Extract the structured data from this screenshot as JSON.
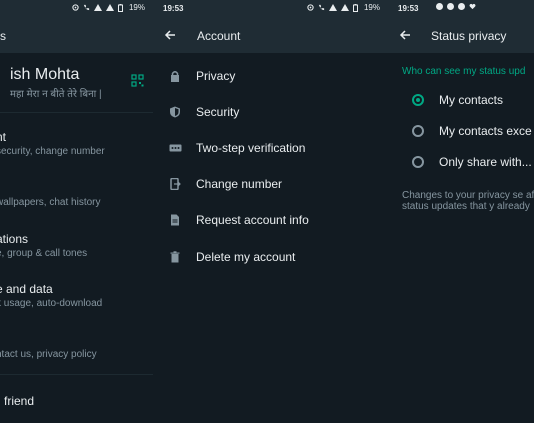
{
  "screen1": {
    "statusbar_battery": "19%",
    "title": "s",
    "profile": {
      "name": "ish Mohta",
      "about": "महा मेरा न बीते तेरे बिना |"
    },
    "rows": [
      {
        "title": "nt",
        "sub": "security, change number"
      },
      {
        "title": "",
        "sub": "wallpapers, chat history"
      },
      {
        "title": "ations",
        "sub": "e, group & call tones"
      },
      {
        "title": "e and data",
        "sub": "k usage, auto-download"
      },
      {
        "title": "",
        "sub": "ntact us, privacy policy"
      }
    ],
    "invite": "friend"
  },
  "screen2": {
    "time": "19:53",
    "battery": "19%",
    "title": "Account",
    "items": [
      {
        "label": "Privacy",
        "icon": "lock-icon"
      },
      {
        "label": "Security",
        "icon": "shield-icon"
      },
      {
        "label": "Two-step verification",
        "icon": "dots-icon"
      },
      {
        "label": "Change number",
        "icon": "phone-change-icon"
      },
      {
        "label": "Request account info",
        "icon": "document-icon"
      },
      {
        "label": "Delete my account",
        "icon": "trash-icon"
      }
    ]
  },
  "screen3": {
    "time": "19:53",
    "title": "Status privacy",
    "section": "Who can see my status upd",
    "options": [
      {
        "label": "My contacts",
        "selected": true
      },
      {
        "label": "My contacts exce",
        "selected": false
      },
      {
        "label": "Only share with...",
        "selected": false
      }
    ],
    "note": "Changes to your privacy se affect status updates that y already"
  },
  "colors": {
    "background": "#121b22",
    "appbar": "#1f2c34",
    "accent": "#00a884",
    "secondary_text": "#8696a0",
    "primary_text": "#e9edef"
  }
}
